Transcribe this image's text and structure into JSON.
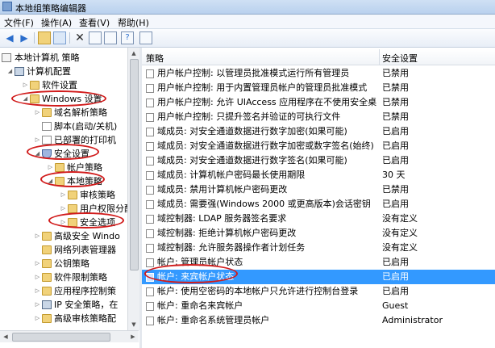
{
  "window": {
    "title": "本地组策略编辑器"
  },
  "menu": [
    "文件(F)",
    "操作(A)",
    "查看(V)",
    "帮助(H)"
  ],
  "toolbar_icons": [
    "back-arrow-icon",
    "forward-arrow-icon",
    "up-folder-icon",
    "show-tree-icon",
    "delete-icon",
    "properties-icon",
    "export-list-icon",
    "help-icon",
    "view-icon"
  ],
  "tree": [
    "本地计算机 策略",
    "计算机配置",
    "软件设置",
    "Windows 设置",
    "域名解析策略",
    "脚本(启动/关机)",
    "已部署的打印机",
    "安全设置",
    "帐户策略",
    "本地策略",
    "审核策略",
    "用户权限分配",
    "安全选项",
    "高级安全 Windo",
    "网络列表管理器",
    "公钥策略",
    "软件限制策略",
    "应用程序控制策",
    "IP 安全策略，在",
    "高级审核策略配"
  ],
  "list": {
    "headers": [
      "策略",
      "安全设置"
    ],
    "rows": [
      {
        "name": "用户帐户控制: 以管理员批准模式运行所有管理员",
        "value": "已禁用"
      },
      {
        "name": "用户帐户控制: 用于内置管理员帐户的管理员批准模式",
        "value": "已禁用"
      },
      {
        "name": "用户帐户控制: 允许 UIAccess 应用程序在不使用安全桌面...",
        "value": "已禁用"
      },
      {
        "name": "用户帐户控制: 只提升签名并验证的可执行文件",
        "value": "已禁用"
      },
      {
        "name": "域成员: 对安全通道数据进行数字加密(如果可能)",
        "value": "已启用"
      },
      {
        "name": "域成员: 对安全通道数据进行数字加密或数字签名(始终)",
        "value": "已启用"
      },
      {
        "name": "域成员: 对安全通道数据进行数字签名(如果可能)",
        "value": "已启用"
      },
      {
        "name": "域成员: 计算机帐户密码最长使用期限",
        "value": "30 天"
      },
      {
        "name": "域成员: 禁用计算机帐户密码更改",
        "value": "已禁用"
      },
      {
        "name": "域成员: 需要强(Windows 2000 或更高版本)会话密钥",
        "value": "已启用"
      },
      {
        "name": "域控制器: LDAP 服务器签名要求",
        "value": "没有定义"
      },
      {
        "name": "域控制器: 拒绝计算机帐户密码更改",
        "value": "没有定义"
      },
      {
        "name": "域控制器: 允许服务器操作者计划任务",
        "value": "没有定义"
      },
      {
        "name": "帐户: 管理员帐户状态",
        "value": "已启用"
      },
      {
        "name": "帐户: 来宾帐户状态",
        "value": "已启用"
      },
      {
        "name": "帐户: 使用空密码的本地帐户只允许进行控制台登录",
        "value": "已启用"
      },
      {
        "name": "帐户: 重命名来宾帐户",
        "value": "Guest"
      },
      {
        "name": "帐户: 重命名系统管理员帐户",
        "value": "Administrator"
      }
    ]
  }
}
